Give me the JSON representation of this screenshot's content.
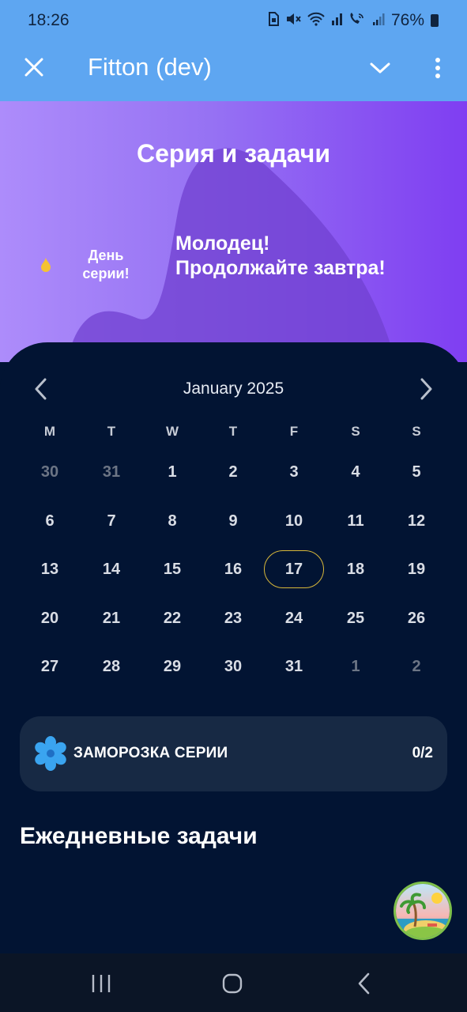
{
  "status_bar": {
    "time": "18:26",
    "icons": [
      "sim-icon",
      "mute-icon",
      "wifi-icon",
      "volte-call-icon",
      "signal-icon"
    ],
    "battery": "76%"
  },
  "app_bar": {
    "title": "Fitton (dev)"
  },
  "hero": {
    "title": "Серия и задачи",
    "streak_label": "День серии!",
    "message_line1": "Молодец!",
    "message_line2": "Продолжайте завтра!"
  },
  "calendar": {
    "month": "January 2025",
    "weekdays": [
      "M",
      "T",
      "W",
      "T",
      "F",
      "S",
      "S"
    ],
    "weeks": [
      [
        {
          "d": "30",
          "muted": true
        },
        {
          "d": "31",
          "muted": true
        },
        {
          "d": "1"
        },
        {
          "d": "2"
        },
        {
          "d": "3"
        },
        {
          "d": "4"
        },
        {
          "d": "5"
        }
      ],
      [
        {
          "d": "6"
        },
        {
          "d": "7"
        },
        {
          "d": "8"
        },
        {
          "d": "9"
        },
        {
          "d": "10"
        },
        {
          "d": "11"
        },
        {
          "d": "12"
        }
      ],
      [
        {
          "d": "13"
        },
        {
          "d": "14"
        },
        {
          "d": "15"
        },
        {
          "d": "16"
        },
        {
          "d": "17",
          "today": true
        },
        {
          "d": "18"
        },
        {
          "d": "19"
        }
      ],
      [
        {
          "d": "20"
        },
        {
          "d": "21"
        },
        {
          "d": "22"
        },
        {
          "d": "23"
        },
        {
          "d": "24"
        },
        {
          "d": "25"
        },
        {
          "d": "26"
        }
      ],
      [
        {
          "d": "27"
        },
        {
          "d": "28"
        },
        {
          "d": "29"
        },
        {
          "d": "30"
        },
        {
          "d": "31"
        },
        {
          "d": "1",
          "muted": true
        },
        {
          "d": "2",
          "muted": true
        }
      ]
    ]
  },
  "freeze": {
    "label": "ЗАМОРОЗКА СЕРИИ",
    "count": "0/2"
  },
  "tasks": {
    "title": "Ежедневные задачи"
  },
  "colors": {
    "app_bar": "#5ea6f1",
    "background": "#021433",
    "freeze_row": "#172944",
    "today_ring": "#d7b73a"
  }
}
